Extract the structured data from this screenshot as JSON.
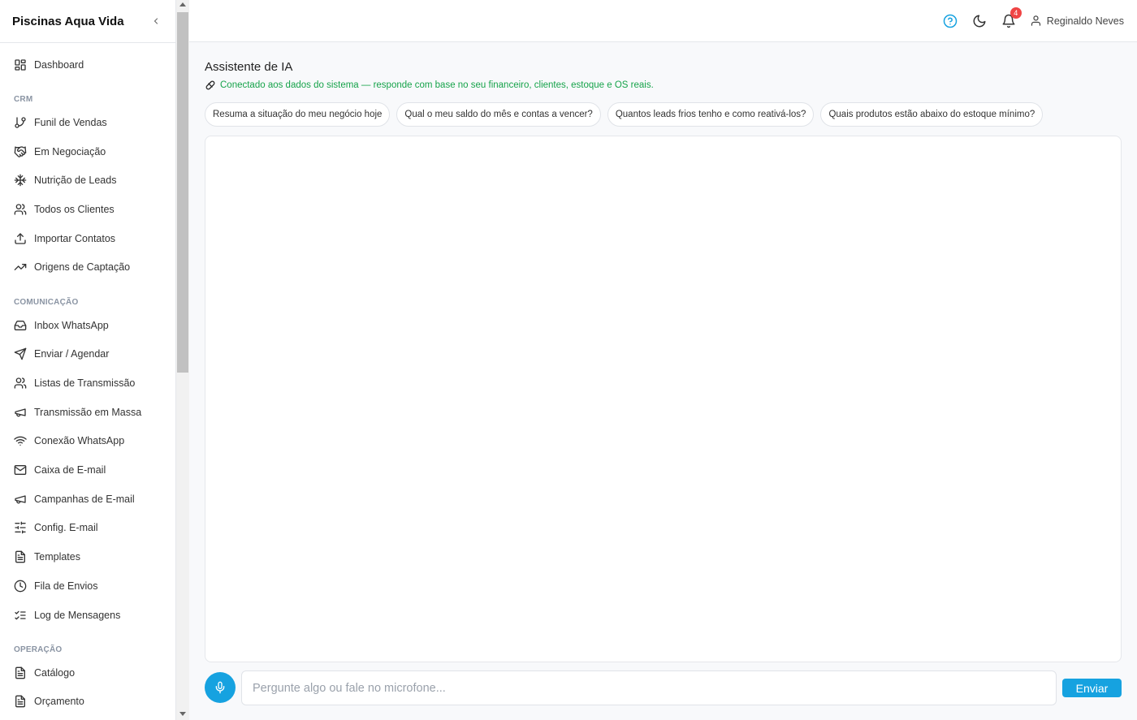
{
  "sidebar": {
    "brand": "Piscinas Aqua Vida",
    "items": [
      {
        "label": "Dashboard",
        "icon": "dashboard-icon"
      },
      {
        "section": "CRM"
      },
      {
        "label": "Funil de Vendas",
        "icon": "git-branch-icon"
      },
      {
        "label": "Em Negociação",
        "icon": "handshake-icon"
      },
      {
        "label": "Nutrição de Leads",
        "icon": "snowflake-icon"
      },
      {
        "label": "Todos os Clientes",
        "icon": "users-icon"
      },
      {
        "label": "Importar Contatos",
        "icon": "upload-icon"
      },
      {
        "label": "Origens de Captação",
        "icon": "trending-up-icon"
      },
      {
        "section": "COMUNICAÇÃO"
      },
      {
        "label": "Inbox WhatsApp",
        "icon": "inbox-icon"
      },
      {
        "label": "Enviar / Agendar",
        "icon": "send-icon"
      },
      {
        "label": "Listas de Transmissão",
        "icon": "users-icon"
      },
      {
        "label": "Transmissão em Massa",
        "icon": "megaphone-icon"
      },
      {
        "label": "Conexão WhatsApp",
        "icon": "wifi-icon"
      },
      {
        "label": "Caixa de E-mail",
        "icon": "mail-icon"
      },
      {
        "label": "Campanhas de E-mail",
        "icon": "megaphone-icon"
      },
      {
        "label": "Config. E-mail",
        "icon": "sliders-icon"
      },
      {
        "label": "Templates",
        "icon": "file-text-icon"
      },
      {
        "label": "Fila de Envios",
        "icon": "clock-icon"
      },
      {
        "label": "Log de Mensagens",
        "icon": "list-checks-icon"
      },
      {
        "section": "OPERAÇÃO"
      },
      {
        "label": "Catálogo",
        "icon": "file-text-icon"
      },
      {
        "label": "Orçamento",
        "icon": "file-text-icon"
      }
    ]
  },
  "topbar": {
    "notifications_count": "4",
    "user_name": "Reginaldo Neves"
  },
  "main": {
    "title": "Assistente de IA",
    "status": "Conectado aos dados do sistema — responde com base no seu financeiro, clientes, estoque e OS reais.",
    "suggestions": [
      "Resuma a situação do meu negócio hoje",
      "Qual o meu saldo do mês e contas a vencer?",
      "Quantos leads frios tenho e como reativá-los?",
      "Quais produtos estão abaixo do estoque mínimo?"
    ],
    "input_placeholder": "Pergunte algo ou fale no microfone...",
    "send_label": "Enviar"
  },
  "colors": {
    "accent": "#16a2e0",
    "status_green": "#16a34a",
    "badge_red": "#ef4444"
  }
}
